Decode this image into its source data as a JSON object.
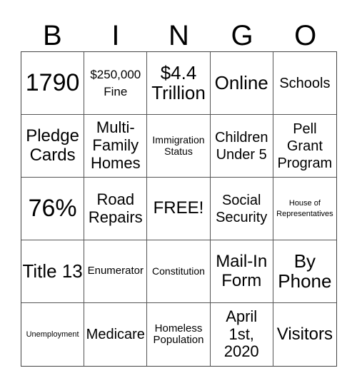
{
  "header": [
    "B",
    "I",
    "N",
    "G",
    "O"
  ],
  "cells": [
    [
      "1790",
      "$250,000 Fine",
      "$4.4 Trillion",
      "Online",
      "Schools"
    ],
    [
      "Pledge Cards",
      "Multi-Family Homes",
      "Immigration Status",
      "Children Under 5",
      "Pell Grant Program"
    ],
    [
      "76%",
      "Road Repairs",
      "FREE!",
      "Social Security",
      "House of Representatives"
    ],
    [
      "Title 13",
      "Enumerator",
      "Constitution",
      "Mail-In Form",
      "By Phone"
    ],
    [
      "Unemployment",
      "Medicare",
      "Homeless Population",
      "April 1st, 2020",
      "Visitors"
    ]
  ]
}
